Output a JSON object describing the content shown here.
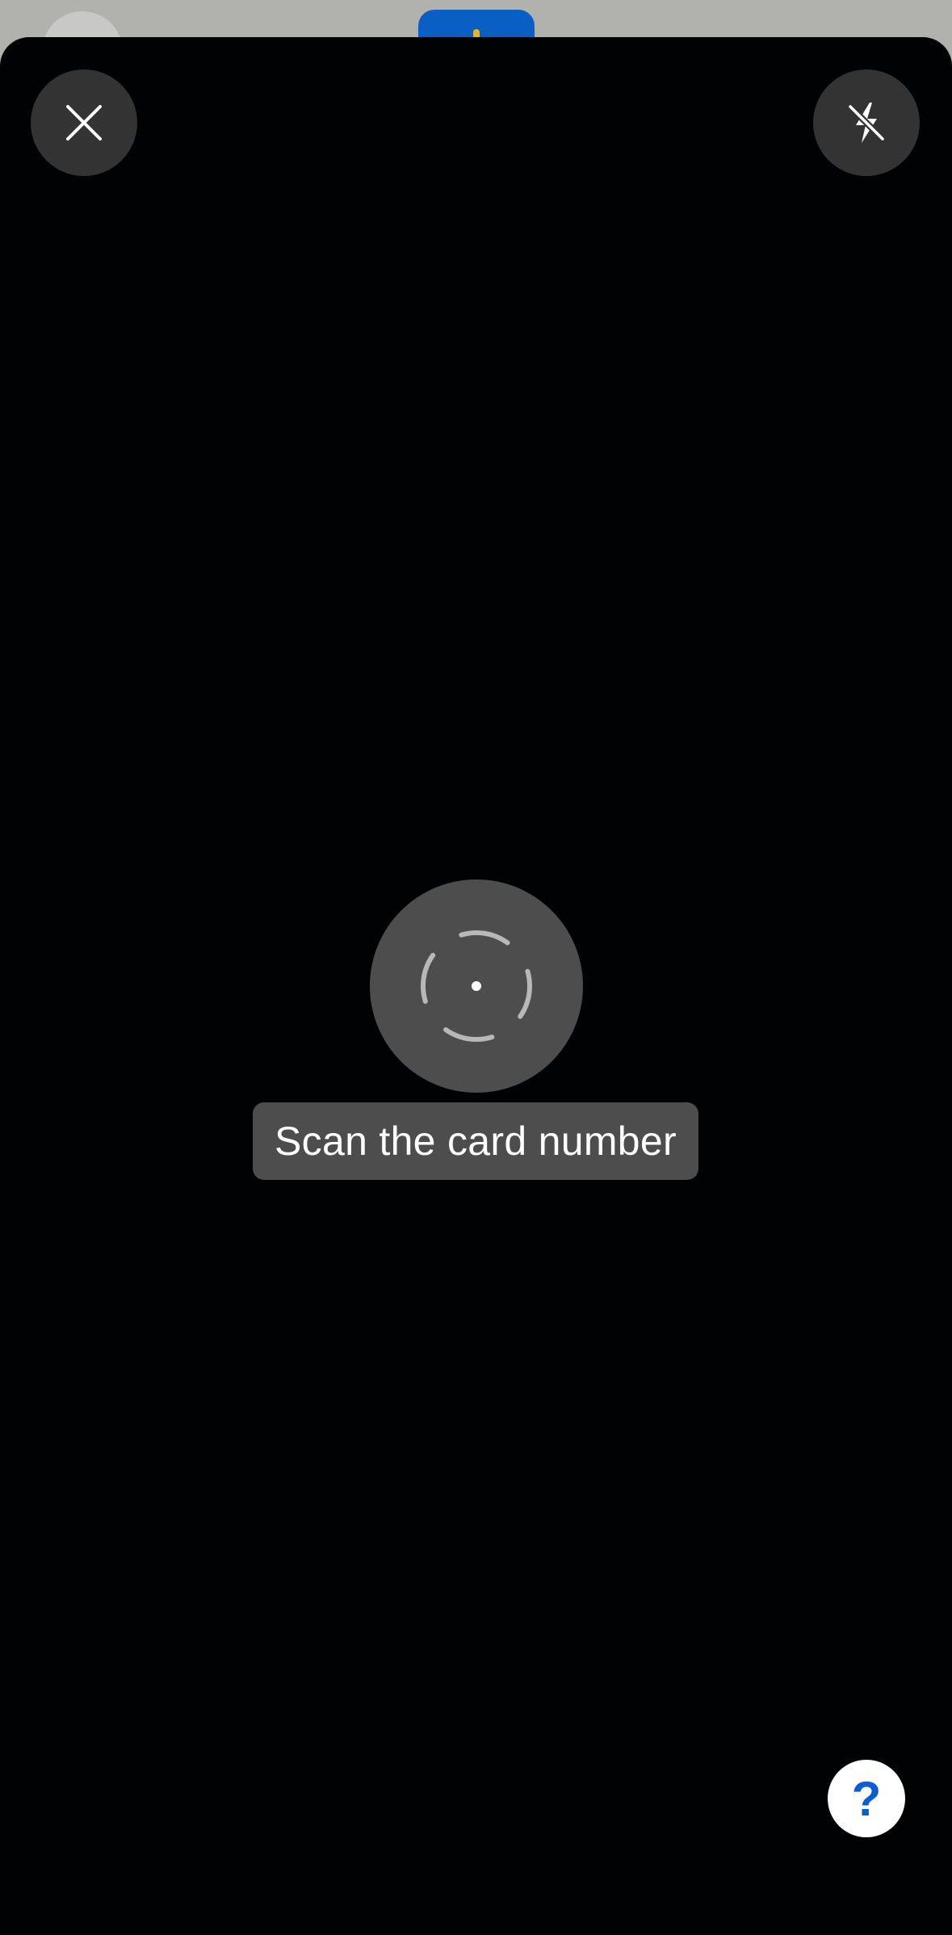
{
  "scanner": {
    "prompt_text": "Scan the card number"
  },
  "controls": {
    "close_icon": "close-icon",
    "flash_icon": "flash-off-icon",
    "help_label": "?"
  },
  "colors": {
    "sheet_background": "#010203",
    "button_background": "#333333",
    "scanner_background": "#4d4d4d",
    "help_accent": "#0a5fd0",
    "backdrop_brand_blue": "#0a5fc4",
    "backdrop_brand_yellow": "#f2b01e"
  }
}
